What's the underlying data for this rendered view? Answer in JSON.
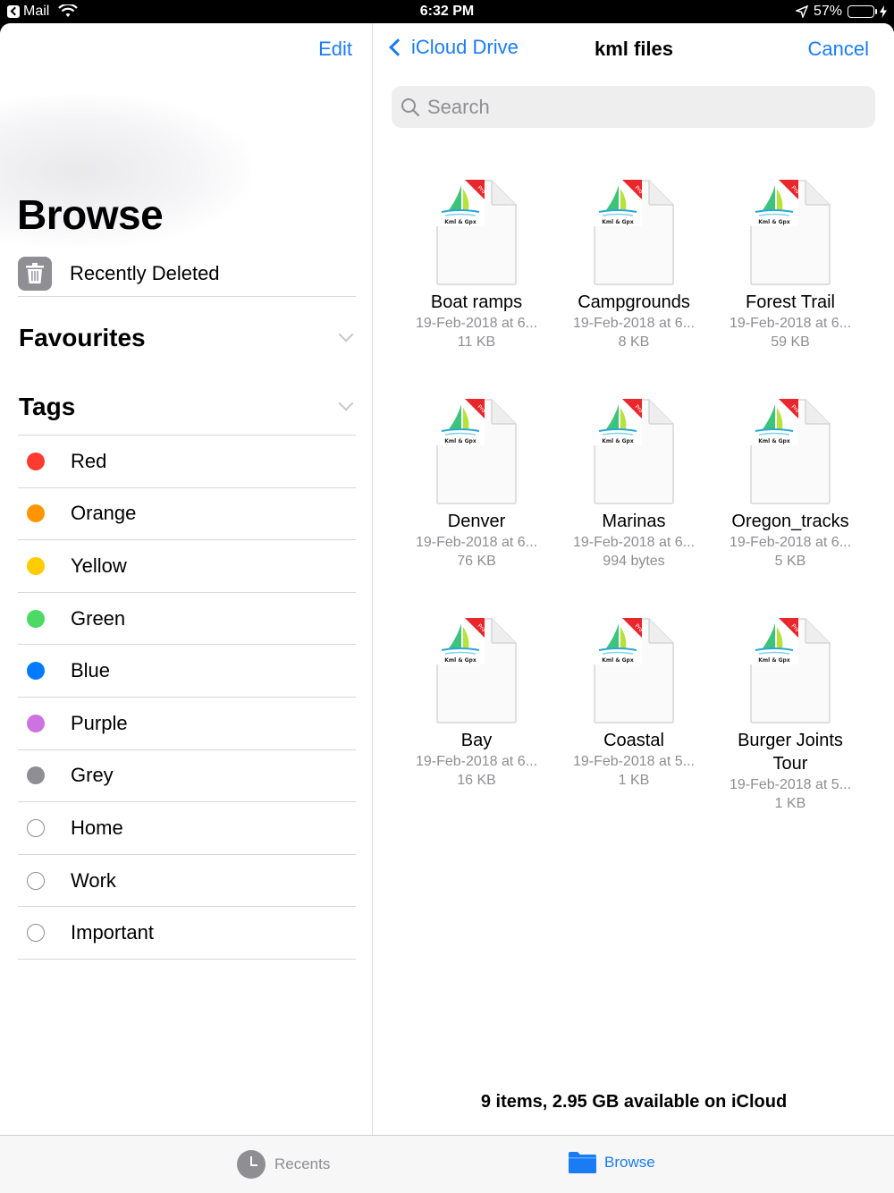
{
  "status_bar": {
    "back_app": "Mail",
    "time": "6:32 PM",
    "battery": "57%",
    "battery_level": 0.57
  },
  "sidebar": {
    "edit_label": "Edit",
    "title": "Browse",
    "recently_deleted": "Recently Deleted",
    "favourites_title": "Favourites",
    "tags_title": "Tags",
    "tags": [
      {
        "label": "Red",
        "color": "#ff3b30",
        "hollow": false
      },
      {
        "label": "Orange",
        "color": "#ff9500",
        "hollow": false
      },
      {
        "label": "Yellow",
        "color": "#ffcc00",
        "hollow": false
      },
      {
        "label": "Green",
        "color": "#4cd964",
        "hollow": false
      },
      {
        "label": "Blue",
        "color": "#007aff",
        "hollow": false
      },
      {
        "label": "Purple",
        "color": "#cc73e1",
        "hollow": false
      },
      {
        "label": "Grey",
        "color": "#8e8e93",
        "hollow": false
      },
      {
        "label": "Home",
        "color": "#ffffff",
        "hollow": true
      },
      {
        "label": "Work",
        "color": "#ffffff",
        "hollow": true
      },
      {
        "label": "Important",
        "color": "#ffffff",
        "hollow": true
      }
    ]
  },
  "main": {
    "back_label": "iCloud Drive",
    "title": "kml files",
    "cancel_label": "Cancel",
    "search_placeholder": "Search",
    "logo_text": "Kml & Gpx",
    "logo_badge": "Pro",
    "files": [
      {
        "name": "Boat ramps",
        "date": "19-Feb-2018 at 6...",
        "size": "11 KB"
      },
      {
        "name": "Campgrounds",
        "date": "19-Feb-2018 at 6...",
        "size": "8 KB"
      },
      {
        "name": "Forest Trail",
        "date": "19-Feb-2018 at 6...",
        "size": "59 KB"
      },
      {
        "name": "Denver",
        "date": "19-Feb-2018 at 6...",
        "size": "76 KB"
      },
      {
        "name": "Marinas",
        "date": "19-Feb-2018 at 6...",
        "size": "994 bytes"
      },
      {
        "name": "Oregon_tracks",
        "date": "19-Feb-2018 at 6...",
        "size": "5 KB"
      },
      {
        "name": "Bay",
        "date": "19-Feb-2018 at 6...",
        "size": "16 KB"
      },
      {
        "name": "Coastal",
        "date": "19-Feb-2018 at 5...",
        "size": "1 KB"
      },
      {
        "name": "Burger Joints Tour",
        "date": "19-Feb-2018 at 5...",
        "size": "1 KB"
      }
    ],
    "footer": "9 items, 2.95 GB available on iCloud"
  },
  "tab_bar": {
    "recents_label": "Recents",
    "browse_label": "Browse"
  },
  "colors": {
    "accent": "#1a7cf5",
    "secondary_text": "#8e8e93"
  }
}
